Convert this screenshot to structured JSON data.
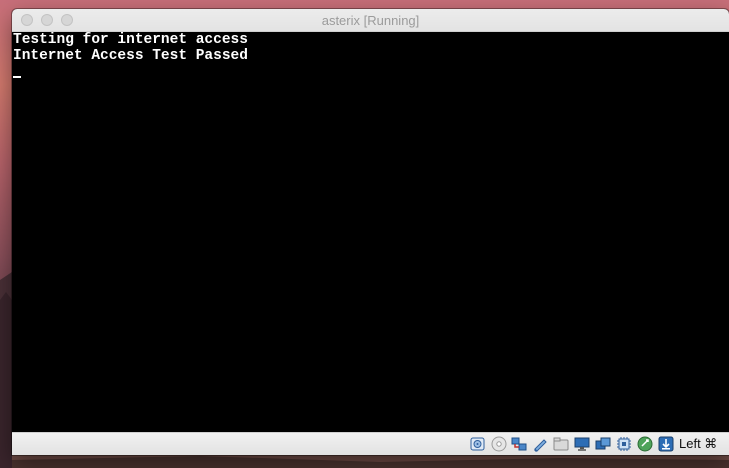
{
  "window": {
    "title": "asterix [Running]"
  },
  "console": {
    "lines": [
      "Testing for internet access",
      "Internet Access Test Passed"
    ]
  },
  "statusbar": {
    "host_key_label": "Left ⌘",
    "icons": [
      "hard-disk-icon",
      "optical-drive-icon",
      "network-icon",
      "usb-icon",
      "shared-folders-icon",
      "display-icon",
      "video-capture-icon",
      "cpu-icon",
      "mouse-integration-icon",
      "keyboard-capture-icon"
    ]
  }
}
